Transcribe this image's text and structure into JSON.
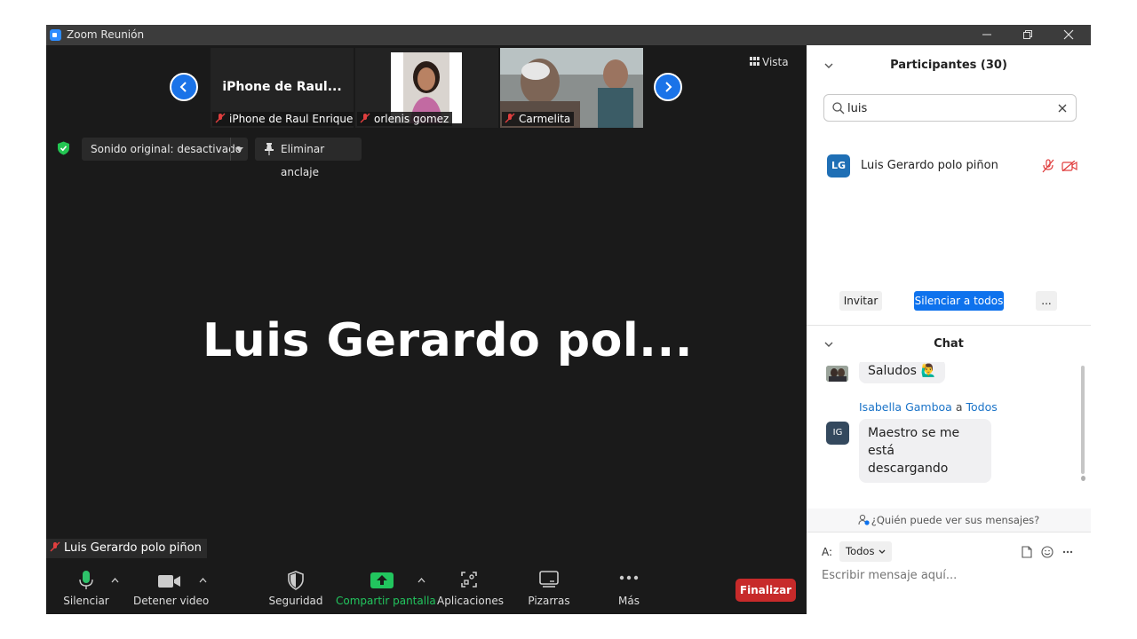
{
  "window": {
    "title": "Zoom Reunión"
  },
  "thumbnails": {
    "prev_label": "Anterior",
    "next_label": "Siguiente",
    "items": [
      {
        "name": "iPhone de Raul Enrique",
        "video_label": "iPhone de Raul..."
      },
      {
        "name": "orlenis gomez"
      },
      {
        "name": "Carmelita"
      }
    ]
  },
  "view": {
    "vista_label": "Vista"
  },
  "controls": {
    "sound_label": "Sonido original: desactivado",
    "unpin_label": "Eliminar anclaje"
  },
  "active_speaker": {
    "display_name": "Luis Gerardo pol...",
    "name_label": "Luis Gerardo polo piñon"
  },
  "toolbar": {
    "mute": "Silenciar",
    "stop_video": "Detener video",
    "security": "Seguridad",
    "share": "Compartir pantalla",
    "apps": "Aplicaciones",
    "whiteboards": "Pizarras",
    "more": "Más",
    "end": "Finalizar"
  },
  "participants": {
    "header": "Participantes (30)",
    "search_value": "luis",
    "list": [
      {
        "initials": "LG",
        "name": "Luis Gerardo polo piñon"
      }
    ],
    "invite": "Invitar",
    "mute_all": "Silenciar a todos",
    "more": "..."
  },
  "chat": {
    "header": "Chat",
    "messages": [
      {
        "text": "Saludos",
        "emoji": "🙋‍♂️"
      },
      {
        "sender": "Isabella Gamboa",
        "connector": "a",
        "recipient": "Todos",
        "initials": "IG",
        "lines": [
          "Maestro se me está",
          "descargando"
        ]
      }
    ],
    "privacy_note": "¿Quién puede ver sus mensajes?",
    "to_label": "A:",
    "to_value": "Todos",
    "input_placeholder": "Escribir mensaje aquí..."
  },
  "colors": {
    "accent": "#0e72ed",
    "danger": "#c72a2a",
    "share_green": "#22c55e",
    "video_bg": "#1a1a1a"
  }
}
